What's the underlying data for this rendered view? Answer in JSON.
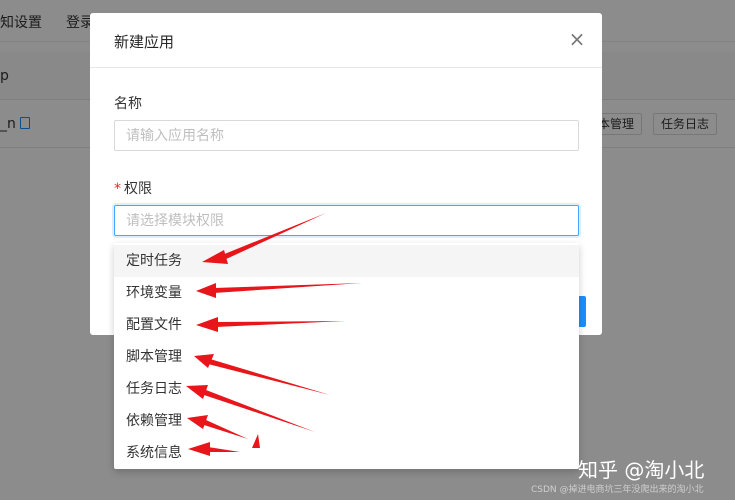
{
  "background": {
    "tabs": [
      "知设置",
      "登录"
    ],
    "row1_text": "p",
    "row2_text": "_n",
    "buttons": [
      "本管理",
      "任务日志"
    ]
  },
  "modal": {
    "title": "新建应用",
    "close_icon": "close-icon",
    "name_label": "名称",
    "name_placeholder": "请输入应用名称",
    "perm_required_mark": "*",
    "perm_label": "权限",
    "perm_placeholder": "请选择模块权限"
  },
  "dropdown": {
    "options": [
      "定时任务",
      "环境变量",
      "配置文件",
      "脚本管理",
      "任务日志",
      "依赖管理",
      "系统信息"
    ],
    "highlighted_option": "定时任务"
  },
  "annotations": {
    "arrow_color": "#e8151b"
  },
  "watermark": {
    "main": "知乎 @淘小北",
    "sub": "CSDN @掉进电商坑三年没爬出来的淘小北"
  }
}
